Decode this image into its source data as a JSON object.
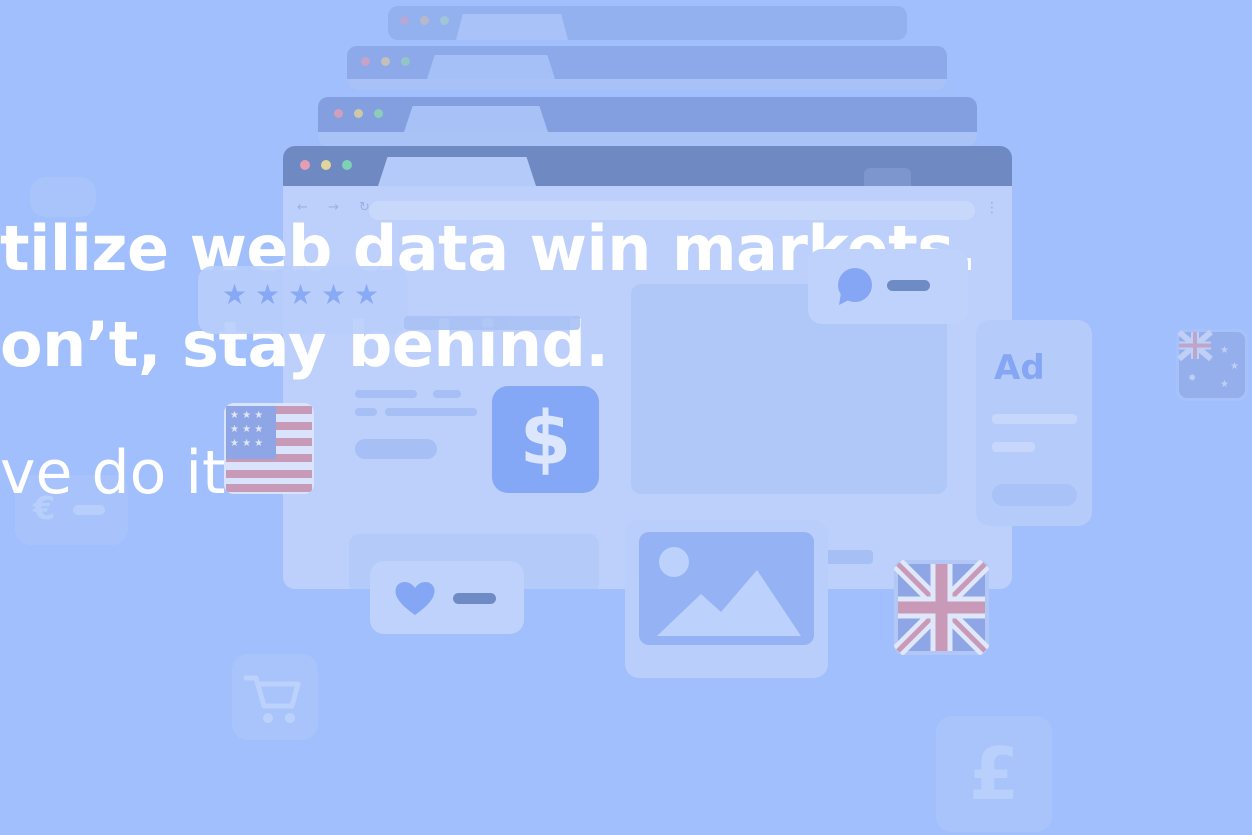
{
  "hero": {
    "headline_line1": "tilize web data win markets.",
    "headline_line2": "on’t, stay behind.",
    "subline": "ve do it."
  },
  "illustration": {
    "dollar_symbol": "$",
    "ad_label": "Ad",
    "pound_symbol": "£",
    "euro_symbol": "€",
    "rating_stars": "★★★★★",
    "browser_nav": "← → ↻",
    "browser_menu": "⋮"
  },
  "colors": {
    "background": "#a0bffc",
    "headline": "#ffffff",
    "accent_blue": "#84a6f5",
    "dot_red": "#e59db5",
    "dot_yellow": "#e2d59c",
    "dot_green": "#7fd1b5"
  },
  "icons": [
    "star-icon",
    "chat-bubble-icon",
    "dollar-icon",
    "heart-icon",
    "image-icon",
    "cart-icon",
    "pound-icon",
    "euro-icon",
    "us-flag-icon",
    "uk-flag-icon",
    "australia-flag-icon"
  ]
}
